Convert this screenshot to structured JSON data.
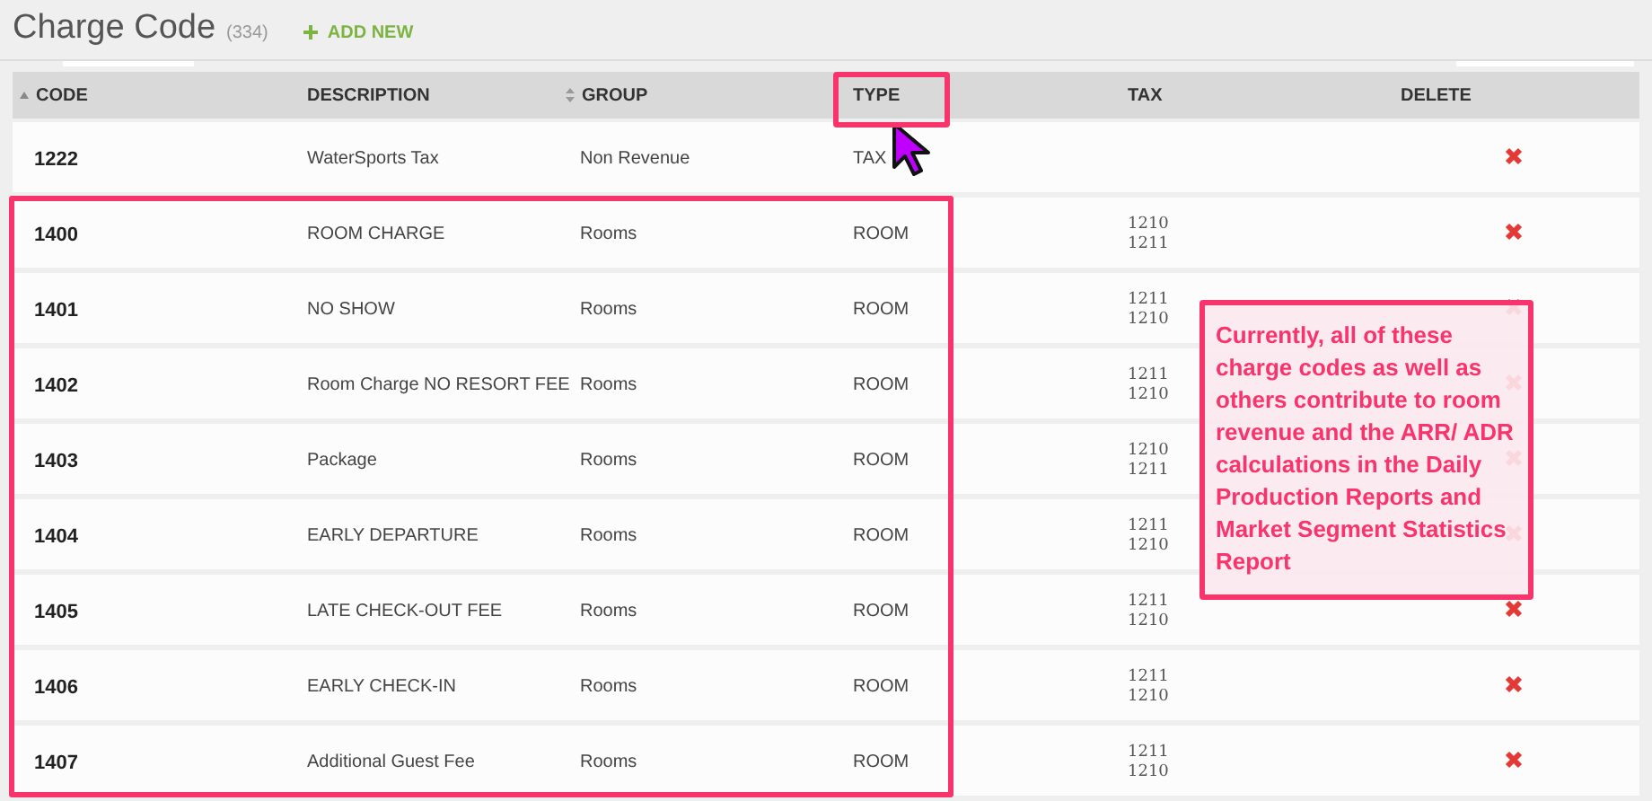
{
  "page": {
    "title": "Charge Code",
    "count": "(334)",
    "add_button": "ADD NEW"
  },
  "table": {
    "columns": [
      {
        "label": "CODE",
        "kind": "sorted",
        "highlighted": false
      },
      {
        "label": "DESCRIPTION",
        "kind": "plain",
        "highlighted": false
      },
      {
        "label": "GROUP",
        "kind": "sortable",
        "highlighted": false
      },
      {
        "label": "TYPE",
        "kind": "plain",
        "highlighted": true
      },
      {
        "label": "TAX",
        "kind": "plain",
        "highlighted": false
      },
      {
        "label": "DELETE",
        "kind": "plain",
        "highlighted": false
      }
    ],
    "rows": [
      {
        "code": "1222",
        "description": "WaterSports Tax",
        "group": "Non Revenue",
        "type": "TAX",
        "tax": [],
        "highlighted": false
      },
      {
        "code": "1400",
        "description": "ROOM CHARGE",
        "group": "Rooms",
        "type": "ROOM",
        "tax": [
          "1210",
          "1211"
        ],
        "highlighted": true
      },
      {
        "code": "1401",
        "description": "NO SHOW",
        "group": "Rooms",
        "type": "ROOM",
        "tax": [
          "1211",
          "1210"
        ],
        "highlighted": true
      },
      {
        "code": "1402",
        "description": "Room Charge NO RESORT FEE",
        "group": "Rooms",
        "type": "ROOM",
        "tax": [
          "1211",
          "1210"
        ],
        "highlighted": true
      },
      {
        "code": "1403",
        "description": "Package",
        "group": "Rooms",
        "type": "ROOM",
        "tax": [
          "1210",
          "1211"
        ],
        "highlighted": true
      },
      {
        "code": "1404",
        "description": "EARLY DEPARTURE",
        "group": "Rooms",
        "type": "ROOM",
        "tax": [
          "1211",
          "1210"
        ],
        "highlighted": true
      },
      {
        "code": "1405",
        "description": "LATE CHECK-OUT FEE",
        "group": "Rooms",
        "type": "ROOM",
        "tax": [
          "1211",
          "1210"
        ],
        "highlighted": true
      },
      {
        "code": "1406",
        "description": "EARLY CHECK-IN",
        "group": "Rooms",
        "type": "ROOM",
        "tax": [
          "1211",
          "1210"
        ],
        "highlighted": true
      },
      {
        "code": "1407",
        "description": "Additional Guest Fee",
        "group": "Rooms",
        "type": "ROOM",
        "tax": [
          "1211",
          "1210"
        ],
        "highlighted": true
      }
    ]
  },
  "callout": {
    "text": "Currently, all of these charge codes as well as others contribute to room revenue and the ARR/ ADR calculations in the Daily Production Reports and Market Segment Statistics Report"
  }
}
